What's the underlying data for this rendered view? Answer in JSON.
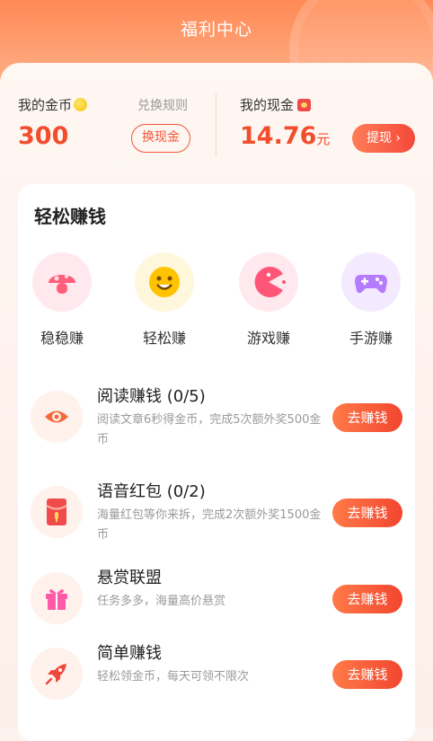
{
  "header": {
    "title": "福利中心"
  },
  "wallet": {
    "coins_label": "我的金币",
    "coins_value": "300",
    "rules_link": "兑换规则",
    "exchange_button": "换现金",
    "cash_label": "我的现金",
    "cash_value": "14.76",
    "cash_unit": "元",
    "withdraw_button": "提现 ›"
  },
  "earn": {
    "title": "轻松赚钱",
    "categories": [
      {
        "label": "稳稳赚",
        "icon": "mushroom-icon",
        "color": "#ff5f7a",
        "bg": "#ffe9ee"
      },
      {
        "label": "轻松赚",
        "icon": "smiley-icon",
        "color": "#ffc300",
        "bg": "#fff7dc"
      },
      {
        "label": "游戏赚",
        "icon": "pacman-icon",
        "color": "#ff5576",
        "bg": "#ffe9ee"
      },
      {
        "label": "手游赚",
        "icon": "gamepad-icon",
        "color": "#b57bff",
        "bg": "#f3eaff"
      }
    ],
    "tasks": [
      {
        "title": "阅读赚钱 (0/5)",
        "desc": "阅读文章6秒得金币，完成5次额外奖500金币",
        "button": "去赚钱",
        "icon": "eye-icon"
      },
      {
        "title": "语音红包 (0/2)",
        "desc": "海量红包等你来拆，完成2次额外奖1500金币",
        "button": "去赚钱",
        "icon": "red-envelope-icon"
      },
      {
        "title": "悬赏联盟",
        "desc": "任务多多，海量高价悬赏",
        "button": "去赚钱",
        "icon": "gift-icon"
      },
      {
        "title": "简单赚钱",
        "desc": "轻松领金币，每天可领不限次",
        "button": "去赚钱",
        "icon": "rocket-icon"
      }
    ]
  },
  "colors": {
    "accent": "#f2462f",
    "header": "#ff8a55"
  }
}
